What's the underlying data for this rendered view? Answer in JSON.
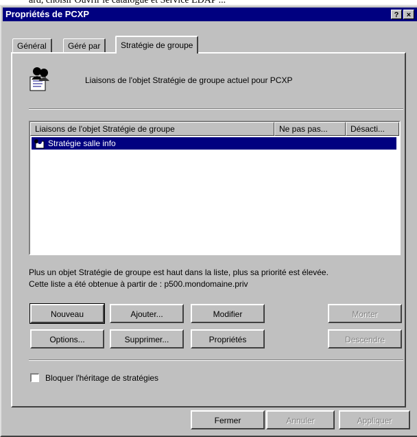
{
  "caption_fragment": "ard, choisir Ouvrir le catalogue et Service LDAP ...",
  "window": {
    "title": "Propriétés de PCXP",
    "help_button": "?",
    "close_button": "×"
  },
  "tabs": [
    {
      "label": "Général",
      "active": false
    },
    {
      "label": "Géré par",
      "active": false
    },
    {
      "label": "Stratégie de groupe",
      "active": true
    }
  ],
  "header": {
    "icon": "group-policy-icon",
    "description": "Liaisons de l'objet Stratégie de groupe actuel pour PCXP"
  },
  "list": {
    "columns": [
      "Liaisons de l'objet Stratégie de groupe",
      "Ne pas pas...",
      "Désacti..."
    ],
    "rows": [
      {
        "name": "Stratégie salle info",
        "no_override": "",
        "disabled": "",
        "selected": true,
        "icon": "gpo-link-icon"
      }
    ]
  },
  "info": {
    "line1": "Plus un objet Stratégie de groupe est haut dans la liste, plus sa priorité est élevée.",
    "line2": "Cette liste a été obtenue à partir de : p500.mondomaine.priv"
  },
  "buttons": {
    "new": "Nouveau",
    "add": "Ajouter...",
    "edit": "Modifier",
    "up": "Monter",
    "options": "Options...",
    "delete": "Supprimer...",
    "properties": "Propriétés",
    "down": "Descendre"
  },
  "block_inheritance": {
    "label": "Bloquer l'héritage de stratégies",
    "checked": false
  },
  "footer": {
    "close": "Fermer",
    "cancel": "Annuler",
    "apply": "Appliquer"
  }
}
